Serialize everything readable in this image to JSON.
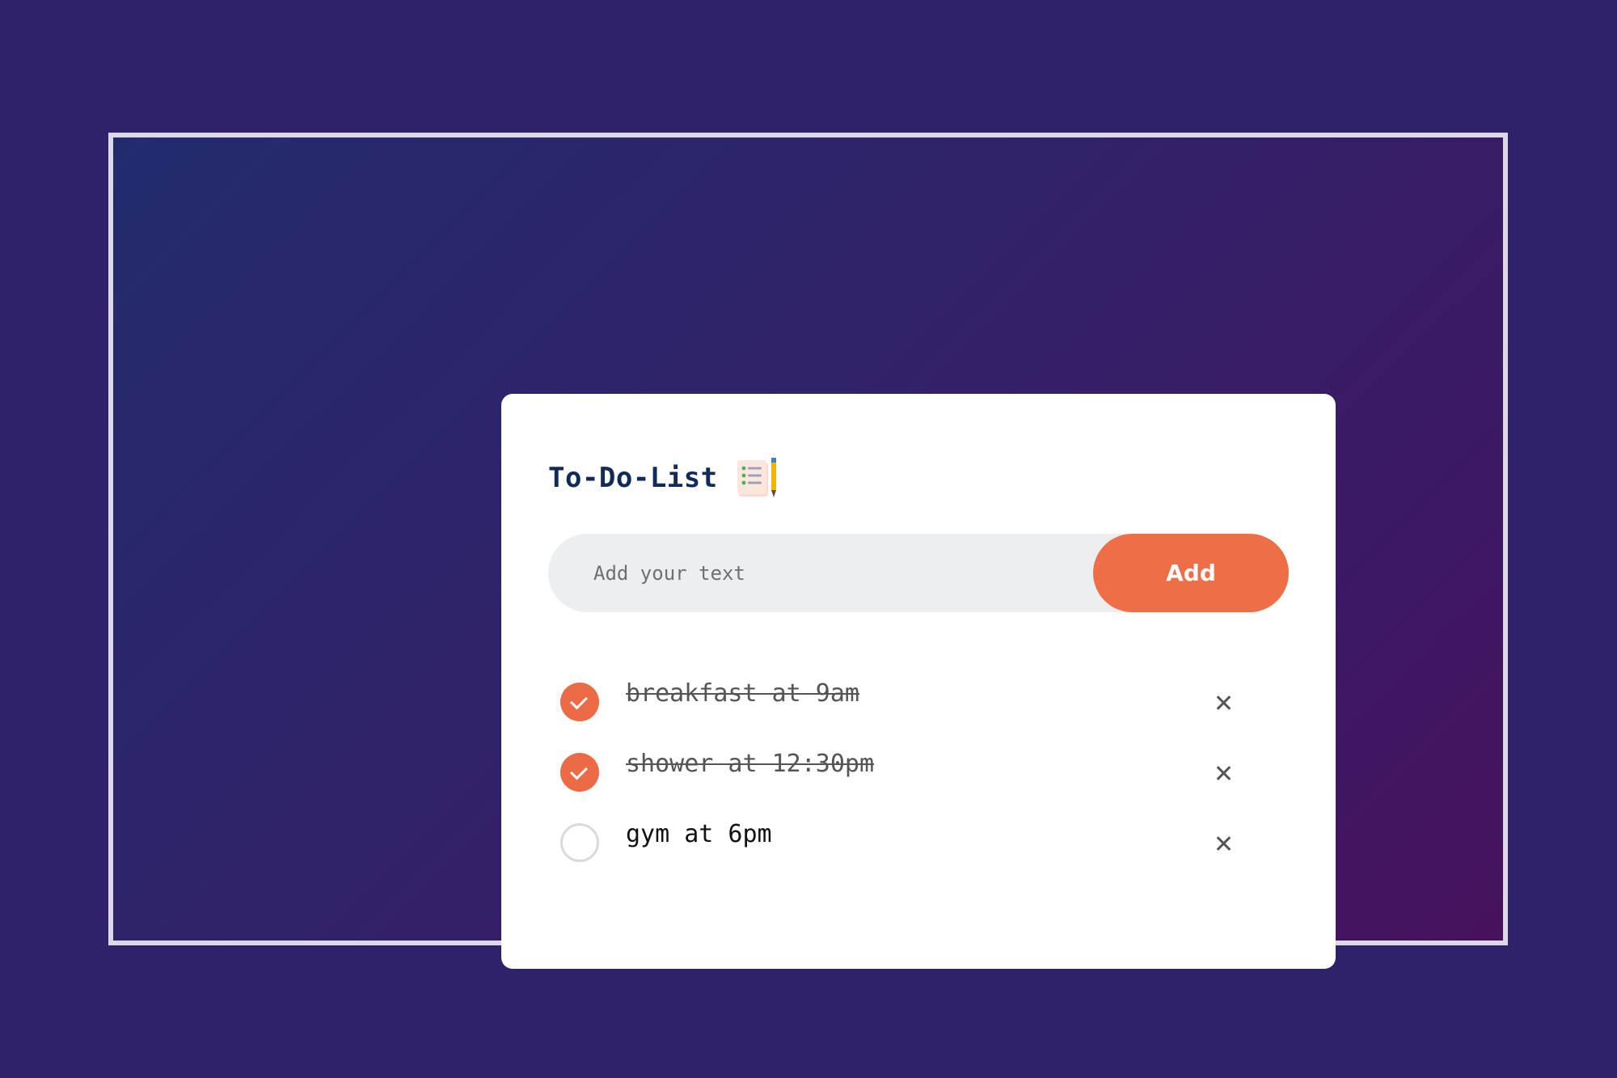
{
  "app": {
    "title": "To-Do-List",
    "title_icon": "checklist-with-pencil-icon"
  },
  "input": {
    "value": "",
    "placeholder": "Add your text",
    "add_label": "Add"
  },
  "todos": [
    {
      "text": "breakfast at 9am",
      "done": true
    },
    {
      "text": "shower at 12:30pm",
      "done": true
    },
    {
      "text": "gym at 6pm",
      "done": false
    }
  ],
  "colors": {
    "accent": "#ee6e48",
    "title": "#102b5a",
    "card": "#ffffff",
    "input_bg": "#edeef0",
    "background_start": "#232b6f",
    "background_end": "#47125e"
  }
}
